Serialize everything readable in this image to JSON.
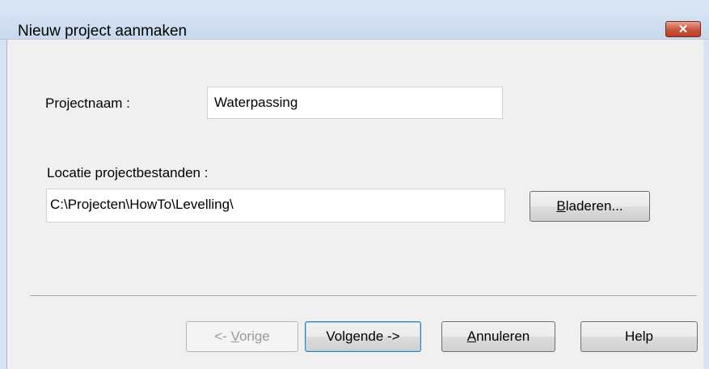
{
  "window": {
    "title": "Nieuw project aanmaken",
    "close_label": "✕"
  },
  "form": {
    "project_name_label": "Projectnaam :",
    "project_name_value": "Waterpassing",
    "location_label": "Locatie projectbestanden :",
    "location_value": "C:\\Projecten\\HowTo\\Levelling\\",
    "browse_label_prefix": "",
    "browse_label_underlined": "B",
    "browse_label_rest": "laderen..."
  },
  "buttons": {
    "prev_prefix": "<- ",
    "prev_underlined": "V",
    "prev_rest": "orige",
    "next_label": "Volgende ->",
    "cancel_underlined": "A",
    "cancel_rest": "nnuleren",
    "help_label": "Help"
  },
  "colors": {
    "titlebar": "#c8d9ee",
    "client_bg": "#f0f0f0",
    "close_button": "#c8533a"
  }
}
